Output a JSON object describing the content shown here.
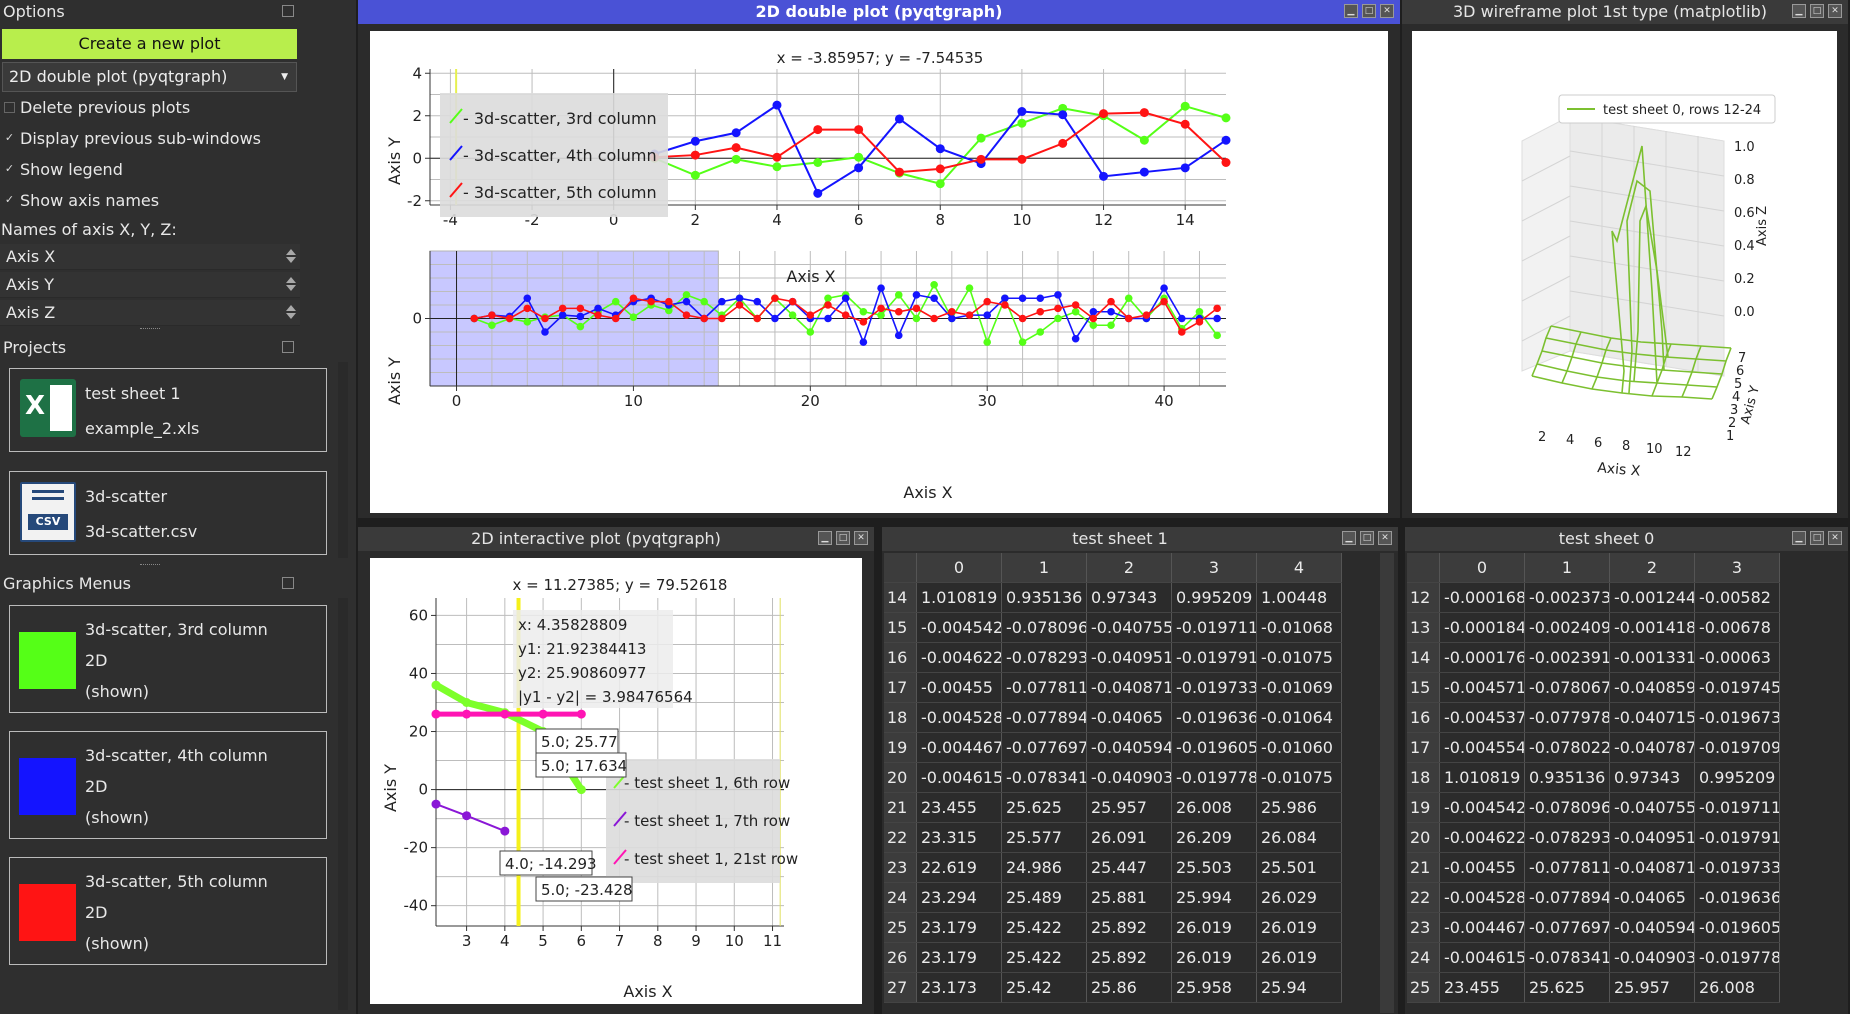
{
  "options": {
    "title": "Options",
    "create_button": "Create a new plot",
    "plot_type_select": "2D double plot (pyqtgraph)",
    "delete_previous": {
      "label": "Delete previous plots",
      "checked": false
    },
    "display_previous": {
      "label": "Display previous sub-windows",
      "checked": true
    },
    "show_legend": {
      "label": "Show legend",
      "checked": true
    },
    "show_axis_names": {
      "label": "Show axis names",
      "checked": true
    },
    "axis_names_label": "Names of axis X, Y, Z:",
    "axis_x": "Axis X",
    "axis_y": "Axis Y",
    "axis_z": "Axis Z",
    "checkmark": "✓"
  },
  "projects": {
    "title": "Projects",
    "items": [
      {
        "name": "test sheet 1",
        "file": "example_2.xls",
        "icon": "excel-icon"
      },
      {
        "name": "3d-scatter",
        "file": "3d-scatter.csv",
        "icon": "csv-icon"
      }
    ],
    "csv_badge": "CSV",
    "excel_badge": "X"
  },
  "graphics_menus": {
    "title": "Graphics Menus",
    "items": [
      {
        "name": "3d-scatter, 3rd column",
        "dim": "2D",
        "state": "(shown)",
        "color": "#55ff17"
      },
      {
        "name": "3d-scatter, 4th column",
        "dim": "2D",
        "state": "(shown)",
        "color": "#1414ff"
      },
      {
        "name": "3d-scatter, 5th column",
        "dim": "2D",
        "state": "(shown)",
        "color": "#ff1414"
      }
    ]
  },
  "windows": {
    "double_plot": {
      "title": "2D double plot (pyqtgraph)",
      "cursor_readout": "x = -3.85957; y = -7.54535",
      "legend": [
        "3d-scatter, 3rd column",
        "3d-scatter, 4th column",
        "3d-scatter, 5th column"
      ],
      "xlabel": "Axis X",
      "ylabel": "Axis Y",
      "top_xticks": [
        "-4",
        "-2",
        "0",
        "2",
        "4",
        "6",
        "8",
        "10",
        "12",
        "14"
      ],
      "top_yticks": [
        "4",
        "2",
        "0",
        "-2"
      ],
      "bottom_xticks": [
        "0",
        "10",
        "20",
        "30",
        "40"
      ],
      "bottom_yticks": [
        "0"
      ]
    },
    "wireframe": {
      "title": "3D wireframe plot 1st type (matplotlib)",
      "legend": "test sheet 0, rows 12-24",
      "xlabel": "Axis X",
      "ylabel": "Axis Y",
      "zlabel": "Axis Z",
      "zticks": [
        "1.0",
        "0.8",
        "0.6",
        "0.4",
        "0.2",
        "0.0"
      ],
      "xticks": [
        "2",
        "4",
        "6",
        "8",
        "10",
        "12"
      ],
      "yticks": [
        "7",
        "6",
        "5",
        "4",
        "3",
        "2",
        "1"
      ]
    },
    "interactive": {
      "title": "2D interactive plot (pyqtgraph)",
      "cursor_readout": "x = 11.27385; y = 79.52618",
      "info_lines": [
        "x: 4.35828809",
        "y1: 21.92384413",
        "y2: 25.90860977",
        "|y1 - y2| = 3.98476564"
      ],
      "tooltips": [
        "5.0; 25.77",
        "5.0; 17.634",
        "4.0; -14.293",
        "5.0; -23.428"
      ],
      "legend": [
        "test sheet 1, 6th row",
        "test sheet 1, 7th row",
        "test sheet 1, 21st row"
      ],
      "xlabel": "Axis X",
      "ylabel": "Axis Y",
      "xticks": [
        "3",
        "4",
        "5",
        "6",
        "7",
        "8",
        "9",
        "10",
        "11"
      ],
      "yticks": [
        "60",
        "40",
        "20",
        "0",
        "-20",
        "-40"
      ]
    },
    "sheet1": {
      "title": "test sheet 1",
      "columns": [
        "0",
        "1",
        "2",
        "3",
        "4"
      ],
      "rows": [
        [
          "14",
          "1.010819",
          "0.935136",
          "0.97343",
          "0.995209",
          "1.00448"
        ],
        [
          "15",
          "-0.004542",
          "-0.078096",
          "-0.040755",
          "-0.019711",
          "-0.01068"
        ],
        [
          "16",
          "-0.004622",
          "-0.078293",
          "-0.040951",
          "-0.019791",
          "-0.01075"
        ],
        [
          "17",
          "-0.00455",
          "-0.077811",
          "-0.040871",
          "-0.019733",
          "-0.01069"
        ],
        [
          "18",
          "-0.004528",
          "-0.077894",
          "-0.04065",
          "-0.019636",
          "-0.01064"
        ],
        [
          "19",
          "-0.004467",
          "-0.077697",
          "-0.040594",
          "-0.019605",
          "-0.01060"
        ],
        [
          "20",
          "-0.004615",
          "-0.078341",
          "-0.040903",
          "-0.019778",
          "-0.01075"
        ],
        [
          "21",
          "23.455",
          "25.625",
          "25.957",
          "26.008",
          "25.986"
        ],
        [
          "22",
          "23.315",
          "25.577",
          "26.091",
          "26.209",
          "26.084"
        ],
        [
          "23",
          "22.619",
          "24.986",
          "25.447",
          "25.503",
          "25.501"
        ],
        [
          "24",
          "23.294",
          "25.489",
          "25.881",
          "25.994",
          "26.029"
        ],
        [
          "25",
          "23.179",
          "25.422",
          "25.892",
          "26.019",
          "26.019"
        ],
        [
          "26",
          "23.179",
          "25.422",
          "25.892",
          "26.019",
          "26.019"
        ],
        [
          "27",
          "23.173",
          "25.42",
          "25.86",
          "25.958",
          "25.94"
        ]
      ]
    },
    "sheet0": {
      "title": "test sheet 0",
      "columns": [
        "0",
        "1",
        "2",
        "3"
      ],
      "rows": [
        [
          "12",
          "-0.000168",
          "-0.002373",
          "-0.001244",
          "-0.00582"
        ],
        [
          "13",
          "-0.000184",
          "-0.002409",
          "-0.001418",
          "-0.00678"
        ],
        [
          "14",
          "-0.000176",
          "-0.002391",
          "-0.001331",
          "-0.00063"
        ],
        [
          "15",
          "-0.004571",
          "-0.078067",
          "-0.040859",
          "-0.019745"
        ],
        [
          "16",
          "-0.004537",
          "-0.077978",
          "-0.040715",
          "-0.019673"
        ],
        [
          "17",
          "-0.004554",
          "-0.078022",
          "-0.040787",
          "-0.019709"
        ],
        [
          "18",
          "1.010819",
          "0.935136",
          "0.97343",
          "0.995209"
        ],
        [
          "19",
          "-0.004542",
          "-0.078096",
          "-0.040755",
          "-0.019711"
        ],
        [
          "20",
          "-0.004622",
          "-0.078293",
          "-0.040951",
          "-0.019791"
        ],
        [
          "21",
          "-0.00455",
          "-0.077811",
          "-0.040871",
          "-0.019733"
        ],
        [
          "22",
          "-0.004528",
          "-0.077894",
          "-0.04065",
          "-0.019636"
        ],
        [
          "23",
          "-0.004467",
          "-0.077697",
          "-0.040594",
          "-0.019605"
        ],
        [
          "24",
          "-0.004615",
          "-0.078341",
          "-0.040903",
          "-0.019778"
        ],
        [
          "25",
          "23.455",
          "25.625",
          "25.957",
          "26.008"
        ]
      ]
    }
  },
  "chart_data": [
    {
      "type": "line",
      "xlim": [
        -4.5,
        15
      ],
      "ylim": [
        -2.2,
        4.2
      ],
      "x": [
        1,
        2,
        3,
        4,
        5,
        6,
        7,
        8,
        9,
        10,
        11,
        12,
        13,
        14,
        15
      ],
      "series": [
        {
          "name": "3d-scatter, 3rd column",
          "color": "#55ff17",
          "values": [
            0.0,
            -0.8,
            -0.05,
            -0.4,
            -0.2,
            0.05,
            -0.7,
            -1.2,
            0.95,
            1.65,
            2.35,
            2.0,
            0.85,
            2.45,
            1.9
          ]
        },
        {
          "name": "3d-scatter, 4th column",
          "color": "#1414ff",
          "values": [
            0.2,
            0.8,
            1.2,
            2.5,
            -1.65,
            -0.45,
            1.85,
            0.45,
            -0.25,
            2.2,
            2.05,
            -0.85,
            -0.65,
            -0.45,
            0.85
          ]
        },
        {
          "name": "3d-scatter, 5th column",
          "color": "#ff1414",
          "values": [
            0.05,
            0.15,
            0.5,
            0.05,
            1.35,
            1.35,
            -0.65,
            -0.5,
            -0.05,
            -0.05,
            0.7,
            2.1,
            2.15,
            1.6,
            -0.2
          ]
        }
      ]
    },
    {
      "type": "line",
      "xlim": [
        -1.5,
        43.5
      ],
      "ylim": [
        -1.0,
        1.0
      ],
      "selection_x": [
        -1.5,
        14.8
      ],
      "x": [
        1,
        2,
        3,
        4,
        5,
        6,
        7,
        8,
        9,
        10,
        11,
        12,
        13,
        14,
        15,
        16,
        17,
        18,
        19,
        20,
        21,
        22,
        23,
        24,
        25,
        26,
        27,
        28,
        29,
        30,
        31,
        32,
        33,
        34,
        35,
        36,
        37,
        38,
        39,
        40,
        41,
        42,
        43
      ],
      "series": [
        {
          "name": "3d-scatter, 3rd column",
          "color": "#55ff17",
          "values": [
            0.0,
            -0.1,
            0.0,
            -0.05,
            0.02,
            0.05,
            -0.12,
            0.1,
            0.25,
            0.02,
            0.2,
            0.12,
            0.35,
            0.25,
            0.05,
            0.3,
            0.0,
            0.3,
            0.05,
            -0.2,
            0.3,
            0.35,
            0.1,
            0.05,
            0.35,
            0.0,
            0.5,
            0.0,
            0.45,
            -0.35,
            0.3,
            -0.35,
            -0.2,
            0.0,
            0.1,
            -0.1,
            -0.1,
            0.3,
            0.0,
            0.3,
            -0.15,
            0.1,
            -0.25
          ]
        },
        {
          "name": "3d-scatter, 4th column",
          "color": "#1414ff",
          "values": [
            0.0,
            0.05,
            0.03,
            0.3,
            -0.2,
            0.05,
            0.03,
            0.15,
            0.05,
            0.25,
            0.3,
            0.2,
            0.25,
            0.0,
            0.25,
            0.3,
            0.25,
            0.0,
            0.25,
            0.0,
            0.0,
            0.3,
            -0.35,
            0.45,
            -0.25,
            0.35,
            0.3,
            0.0,
            0.05,
            0.05,
            0.3,
            0.3,
            0.3,
            0.35,
            -0.3,
            0.1,
            0.1,
            0.0,
            0.0,
            0.45,
            0.0,
            0.0,
            0.0
          ]
        },
        {
          "name": "3d-scatter, 5th column",
          "color": "#ff1414",
          "values": [
            0.0,
            0.05,
            0.0,
            0.15,
            0.0,
            0.15,
            0.15,
            0.05,
            0.0,
            0.3,
            0.25,
            0.25,
            0.05,
            0.0,
            0.0,
            0.2,
            0.0,
            0.3,
            0.25,
            0.05,
            0.2,
            0.05,
            -0.05,
            0.15,
            0.1,
            0.15,
            0.0,
            0.1,
            0.05,
            0.25,
            0.2,
            0.0,
            0.1,
            0.15,
            0.2,
            0.0,
            0.25,
            0.0,
            0.05,
            0.25,
            -0.2,
            -0.05,
            0.15
          ]
        }
      ]
    },
    {
      "type": "line",
      "xlim": [
        2.2,
        11.3
      ],
      "ylim": [
        -47,
        66
      ],
      "cursor_x": 4.358,
      "series": [
        {
          "name": "test sheet 1, 6th row",
          "color": "#7dff2a",
          "x": [
            2.2,
            3,
            4,
            5,
            6
          ],
          "values": [
            36,
            30,
            26.5,
            20,
            0
          ]
        },
        {
          "name": "test sheet 1, 7th row",
          "color": "#8a17d6",
          "x": [
            2.2,
            3,
            4
          ],
          "values": [
            -5,
            -9,
            -14.3
          ]
        },
        {
          "name": "test sheet 1, 21st row",
          "color": "#ff14b4",
          "x": [
            2.2,
            3,
            4,
            5,
            6
          ],
          "values": [
            26,
            26,
            26,
            26,
            26
          ]
        }
      ]
    }
  ]
}
